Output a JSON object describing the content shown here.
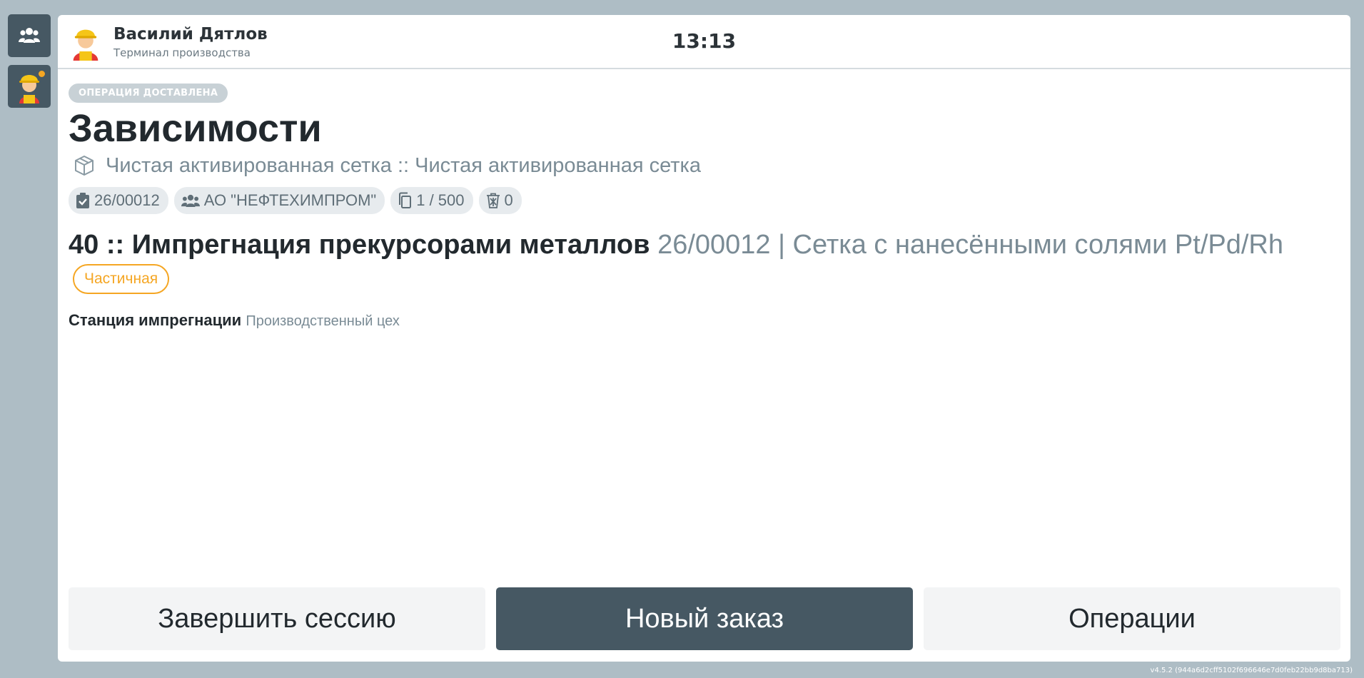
{
  "user": {
    "name": "Василий Дятлов",
    "role": "Терминал производства"
  },
  "clock": "13:13",
  "status": "ОПЕРАЦИЯ ДОСТАВЛЕНА",
  "title": "Зависимости",
  "product": "Чистая активированная сетка :: Чистая активированная сетка",
  "chips": {
    "order": "26/00012",
    "customer": "АО \"НЕФТЕХИМПРОМ\"",
    "quantity": "1 / 500",
    "waste": "0"
  },
  "operation": {
    "code": "40 :: Импрегнация прекурсорами металлов",
    "description": "26/00012 | Сетка с нанесёнными солями Pt/Pd/Rh",
    "badge": "Частичная"
  },
  "station": {
    "name": "Станция импрегнации",
    "place": "Производственный цех"
  },
  "actions": {
    "end_session": "Завершить сессию",
    "new_order": "Новый заказ",
    "operations": "Операции"
  },
  "version": "v4.5.2 (944a6d2cff5102f696646e7d0feb22bb9d8ba713)",
  "colors": {
    "accent": "#465863",
    "badge_orange": "#f5a623",
    "background": "#aebdc5"
  },
  "icons": {
    "sidebar_users": "users-icon",
    "sidebar_worker": "worker-avatar-icon",
    "product": "box-icon",
    "order": "clipboard-check-icon",
    "customer": "users-icon",
    "quantity": "copy-icon",
    "waste": "trash-icon"
  }
}
